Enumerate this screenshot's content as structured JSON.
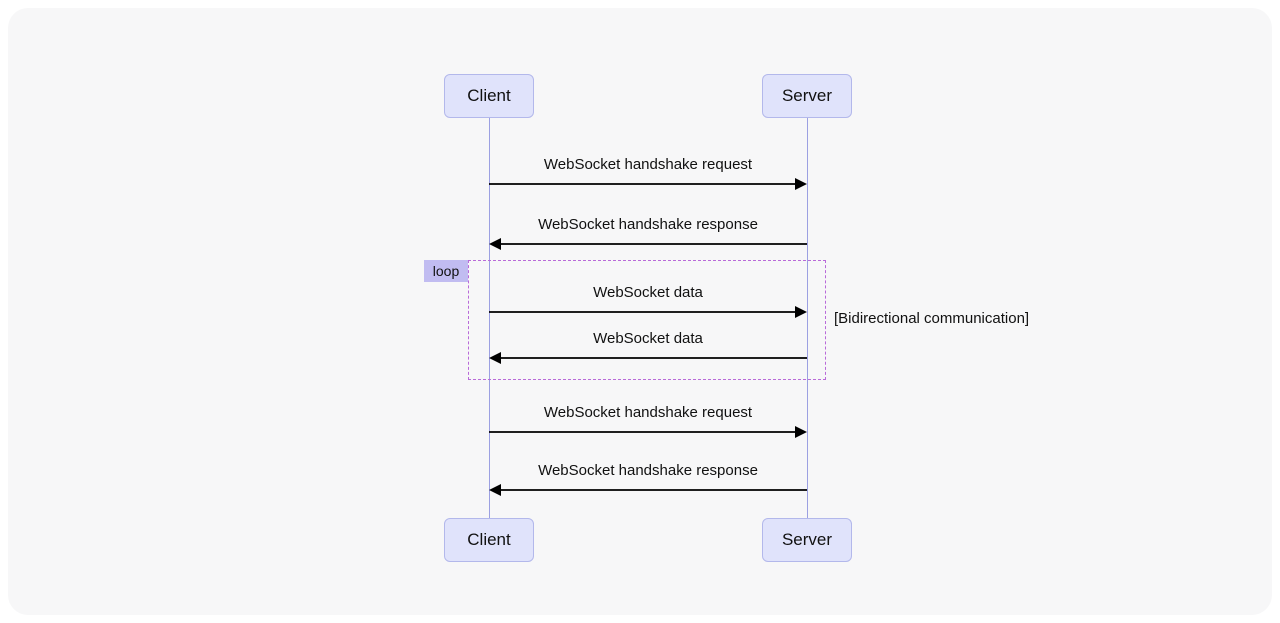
{
  "actors": {
    "client": "Client",
    "server": "Server"
  },
  "messages": {
    "m1": "WebSocket handshake request",
    "m2": "WebSocket handshake response",
    "m3": "WebSocket data",
    "m4": "WebSocket data",
    "m5": "WebSocket handshake request",
    "m6": "WebSocket handshake response"
  },
  "loop": {
    "tag": "loop",
    "note": "[Bidirectional communication]"
  }
}
